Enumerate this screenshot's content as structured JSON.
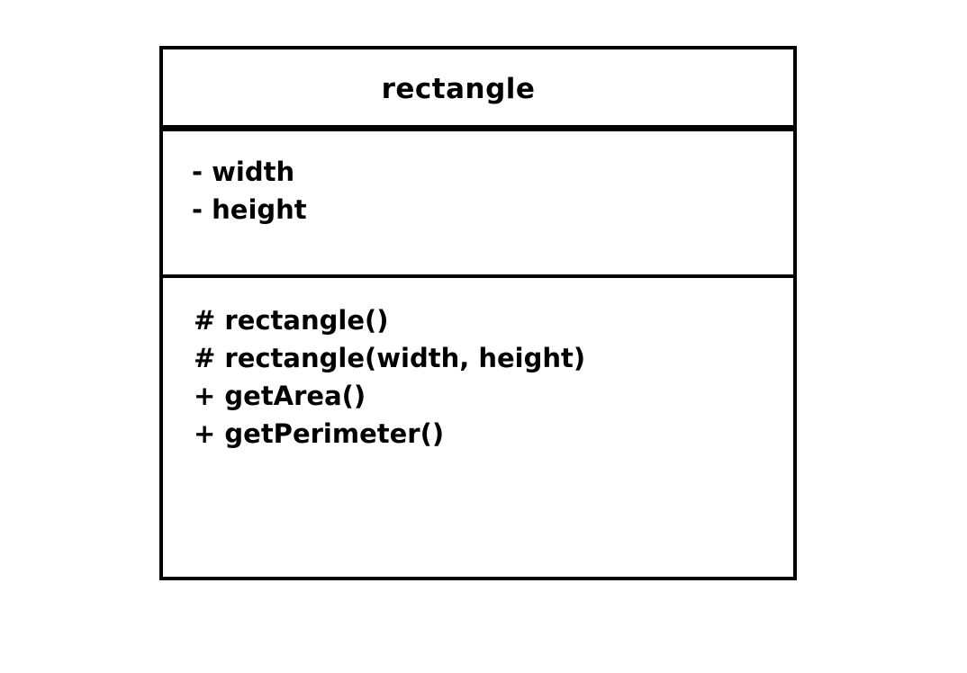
{
  "uml_class": {
    "name": "rectangle",
    "attributes": [
      "- width",
      "- height"
    ],
    "operations": [
      "# rectangle()",
      "# rectangle(width, height)",
      "+ getArea()",
      "+ getPerimeter()"
    ]
  }
}
